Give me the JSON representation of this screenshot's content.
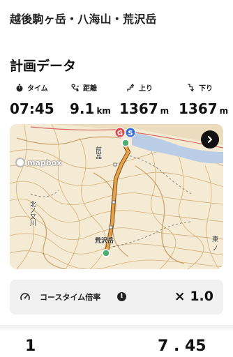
{
  "header": {
    "title": "越後駒ヶ岳・八海山・荒沢岳"
  },
  "plan": {
    "section_title": "計画データ",
    "stats": [
      {
        "icon": "stopwatch-icon",
        "label": "タイム",
        "value": "07:45",
        "unit": ""
      },
      {
        "icon": "route-distance-icon",
        "label": "距離",
        "value": "9.1",
        "unit": "km"
      },
      {
        "icon": "ascent-arrow-icon",
        "label": "上り",
        "value": "1367",
        "unit": "m"
      },
      {
        "icon": "descent-arrow-icon",
        "label": "下り",
        "value": "1367",
        "unit": "m"
      }
    ]
  },
  "map": {
    "attribution": "mapbox",
    "labels": {
      "peak": "荒沢岳",
      "river": "北ノ又川",
      "area_top": "前嵓",
      "area_right": "東ノ"
    },
    "markers": {
      "goal": "G",
      "start": "S"
    },
    "colors": {
      "route": "#e8a24a",
      "goal": "#e0474c",
      "start": "#3a6fd8",
      "water": "#b9cde6"
    }
  },
  "course_time": {
    "label": "コースタイム倍率",
    "info_glyph": "i",
    "value": "× 1.0"
  },
  "footer_peek": {
    "left": "1",
    "right": "7 . 45"
  }
}
